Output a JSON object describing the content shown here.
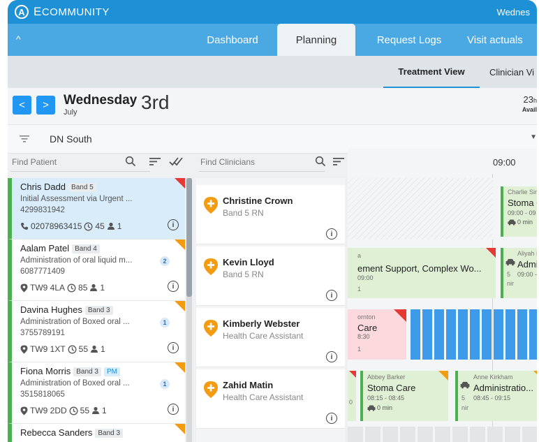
{
  "brand": {
    "logo_letter": "A",
    "name_prefix": "E",
    "name_main": "COMMUNITY"
  },
  "header": {
    "date_text": "Wednes"
  },
  "nav": {
    "collapse": "^",
    "tabs": [
      {
        "label": "Dashboard"
      },
      {
        "label": "Planning"
      },
      {
        "label": "Request Logs"
      },
      {
        "label": "Visit actuals"
      }
    ]
  },
  "subnav": {
    "tabs": [
      {
        "label": "Treatment View"
      },
      {
        "label": "Clinician Vi"
      }
    ]
  },
  "datebar": {
    "prev": "<",
    "next": ">",
    "weekday": "Wednesday",
    "month": "July",
    "day": "3rd",
    "available_hours": "23",
    "available_unit": "h",
    "available_label": "Avail"
  },
  "filter": {
    "area": "DN South"
  },
  "patient_search": {
    "placeholder": "Find Patient"
  },
  "clinician_search": {
    "placeholder": "Find Clinicians"
  },
  "patients": [
    {
      "name": "Chris Dadd",
      "band": "Band 5",
      "desc": "Initial Assessment via Urgent ...",
      "number": "4299831942",
      "contact": "02078963415",
      "duration": "45",
      "people": "1",
      "info": "i"
    },
    {
      "name": "Aalam Patel",
      "band": "Band 4",
      "desc": "Administration of oral liquid m...",
      "count": "2",
      "number": "6087771409",
      "contact": "TW9 4LA",
      "duration": "85",
      "people": "1",
      "info": "i"
    },
    {
      "name": "Davina Hughes",
      "band": "Band 3",
      "desc": "Administration of Boxed oral ...",
      "count": "1",
      "number": "3755789191",
      "contact": "TW9 1XT",
      "duration": "55",
      "people": "1",
      "info": "i"
    },
    {
      "name": "Fiona Morris",
      "band": "Band 3",
      "tag": "PM",
      "desc": "Administration of Boxed oral ...",
      "count": "1",
      "number": "3515818065",
      "contact": "TW9 2DD",
      "duration": "55",
      "people": "1",
      "info": "i"
    },
    {
      "name": "Rebecca Sanders",
      "band": "Band 3"
    }
  ],
  "clinicians": [
    {
      "name": "Christine Crown",
      "role": "Band 5 RN",
      "info": "i"
    },
    {
      "name": "Kevin Lloyd",
      "role": "Band 5 RN",
      "info": "i"
    },
    {
      "name": "Kimberly Webster",
      "role": "Health Care Assistant",
      "info": "i"
    },
    {
      "name": "Zahid Matin",
      "role": "Health Care Assistant",
      "info": "i"
    }
  ],
  "timeline": {
    "hour_label": "09:00",
    "visits": [
      {
        "name": "Charlie Sin",
        "title": "Stoma C",
        "time": "09:00 - 09",
        "travel": "0 min"
      },
      {
        "prefix": "a",
        "title": "ement Support, Complex Wo...",
        "time": "09:00",
        "suffix": "1"
      },
      {
        "name": "Aliyah B",
        "title": "Admin",
        "sub": "5",
        "time": "09:00 -",
        "nir": "nir"
      },
      {
        "prefix": "ornton",
        "title": "Care",
        "time": "8:30",
        "suffix": "1"
      },
      {
        "name": "Abbey Barker",
        "title": "Stoma Care",
        "time": "08:15 - 08:45",
        "travel": "0 min",
        "lead": "0"
      },
      {
        "name": "Anne Kirkham",
        "title": "Administratio...",
        "sub": "5",
        "time": "08:45 - 09:15",
        "nir": "nir"
      }
    ]
  },
  "colors": {
    "brand_dark": "#1e90d6",
    "brand_light": "#4aa8e3",
    "accent_blue": "#2196f3",
    "band_green": "#4caf50",
    "flag_red": "#e53935",
    "flag_orange": "#f39c12",
    "clinician_orange": "#f39c12"
  }
}
